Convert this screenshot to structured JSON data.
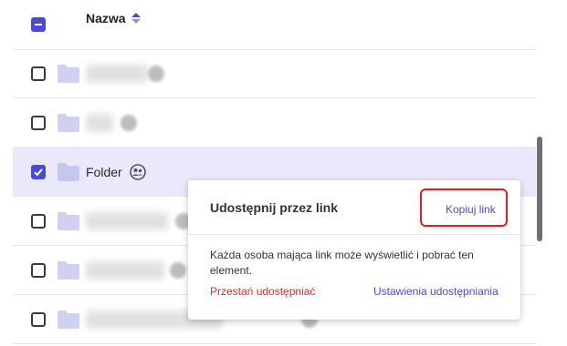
{
  "header": {
    "column_label": "Nazwa",
    "select_all_state": "indeterminate",
    "sort_icon": "sort-ascending-icon"
  },
  "rows": [
    {
      "name": "",
      "blurred": true,
      "checked": false
    },
    {
      "name": "",
      "blurred": true,
      "checked": false
    },
    {
      "name": "Folder",
      "blurred": false,
      "checked": true,
      "shared": true
    },
    {
      "name": "",
      "blurred": true,
      "checked": false
    },
    {
      "name": "",
      "blurred": true,
      "checked": false
    },
    {
      "name": "",
      "blurred": true,
      "checked": false
    }
  ],
  "share_popup": {
    "title": "Udostępnij przez link",
    "copy_link": "Kopiuj link",
    "description": "Każda osoba mająca link może wyświetlić i pobrać ten element.",
    "stop_sharing": "Przestań udostępniać",
    "sharing_settings": "Ustawienia udostępniania"
  },
  "colors": {
    "accent": "#4a4bd4",
    "selected_row": "#e9e9fb",
    "danger": "#d32f2f",
    "highlight_border": "#e0201e",
    "folder": "#d0d1f2"
  }
}
